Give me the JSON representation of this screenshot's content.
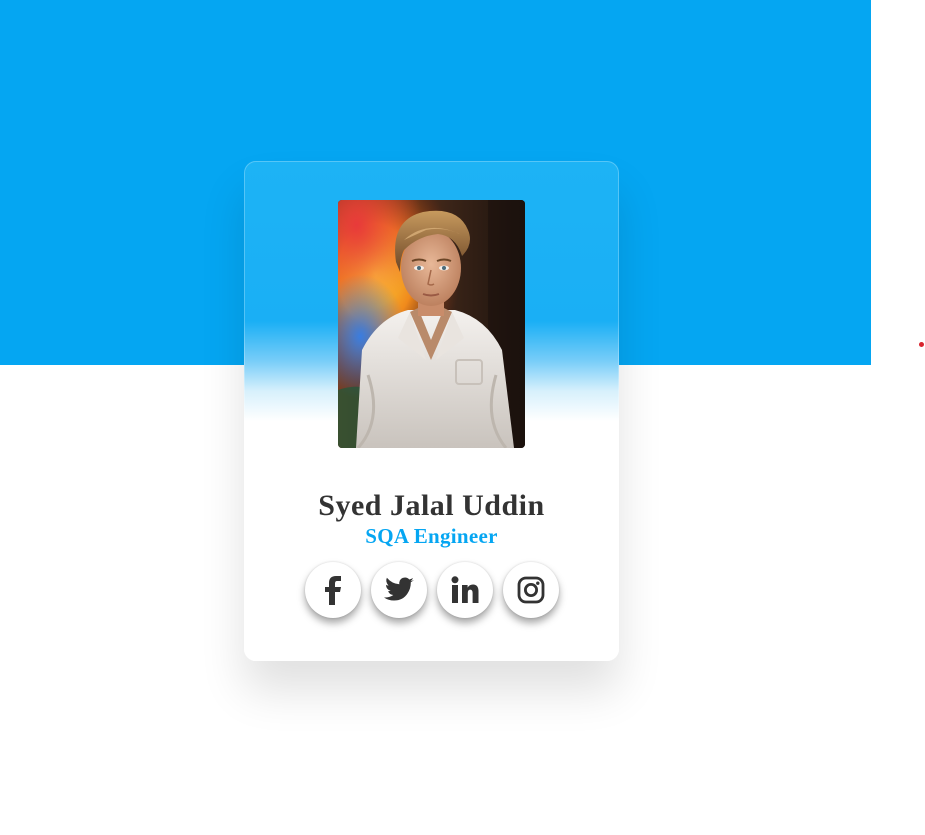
{
  "profile": {
    "name": "Syed Jalal Uddin",
    "role": "SQA Engineer",
    "photo_icon": "profile-photo"
  },
  "socials": [
    {
      "id": "facebook",
      "icon": "facebook-icon"
    },
    {
      "id": "twitter",
      "icon": "twitter-icon"
    },
    {
      "id": "linkedin",
      "icon": "linkedin-icon"
    },
    {
      "id": "instagram",
      "icon": "instagram-icon"
    }
  ],
  "colors": {
    "accent": "#05a6f2",
    "name_text": "#333333",
    "icon": "#333333",
    "dot": "#d9232d"
  }
}
